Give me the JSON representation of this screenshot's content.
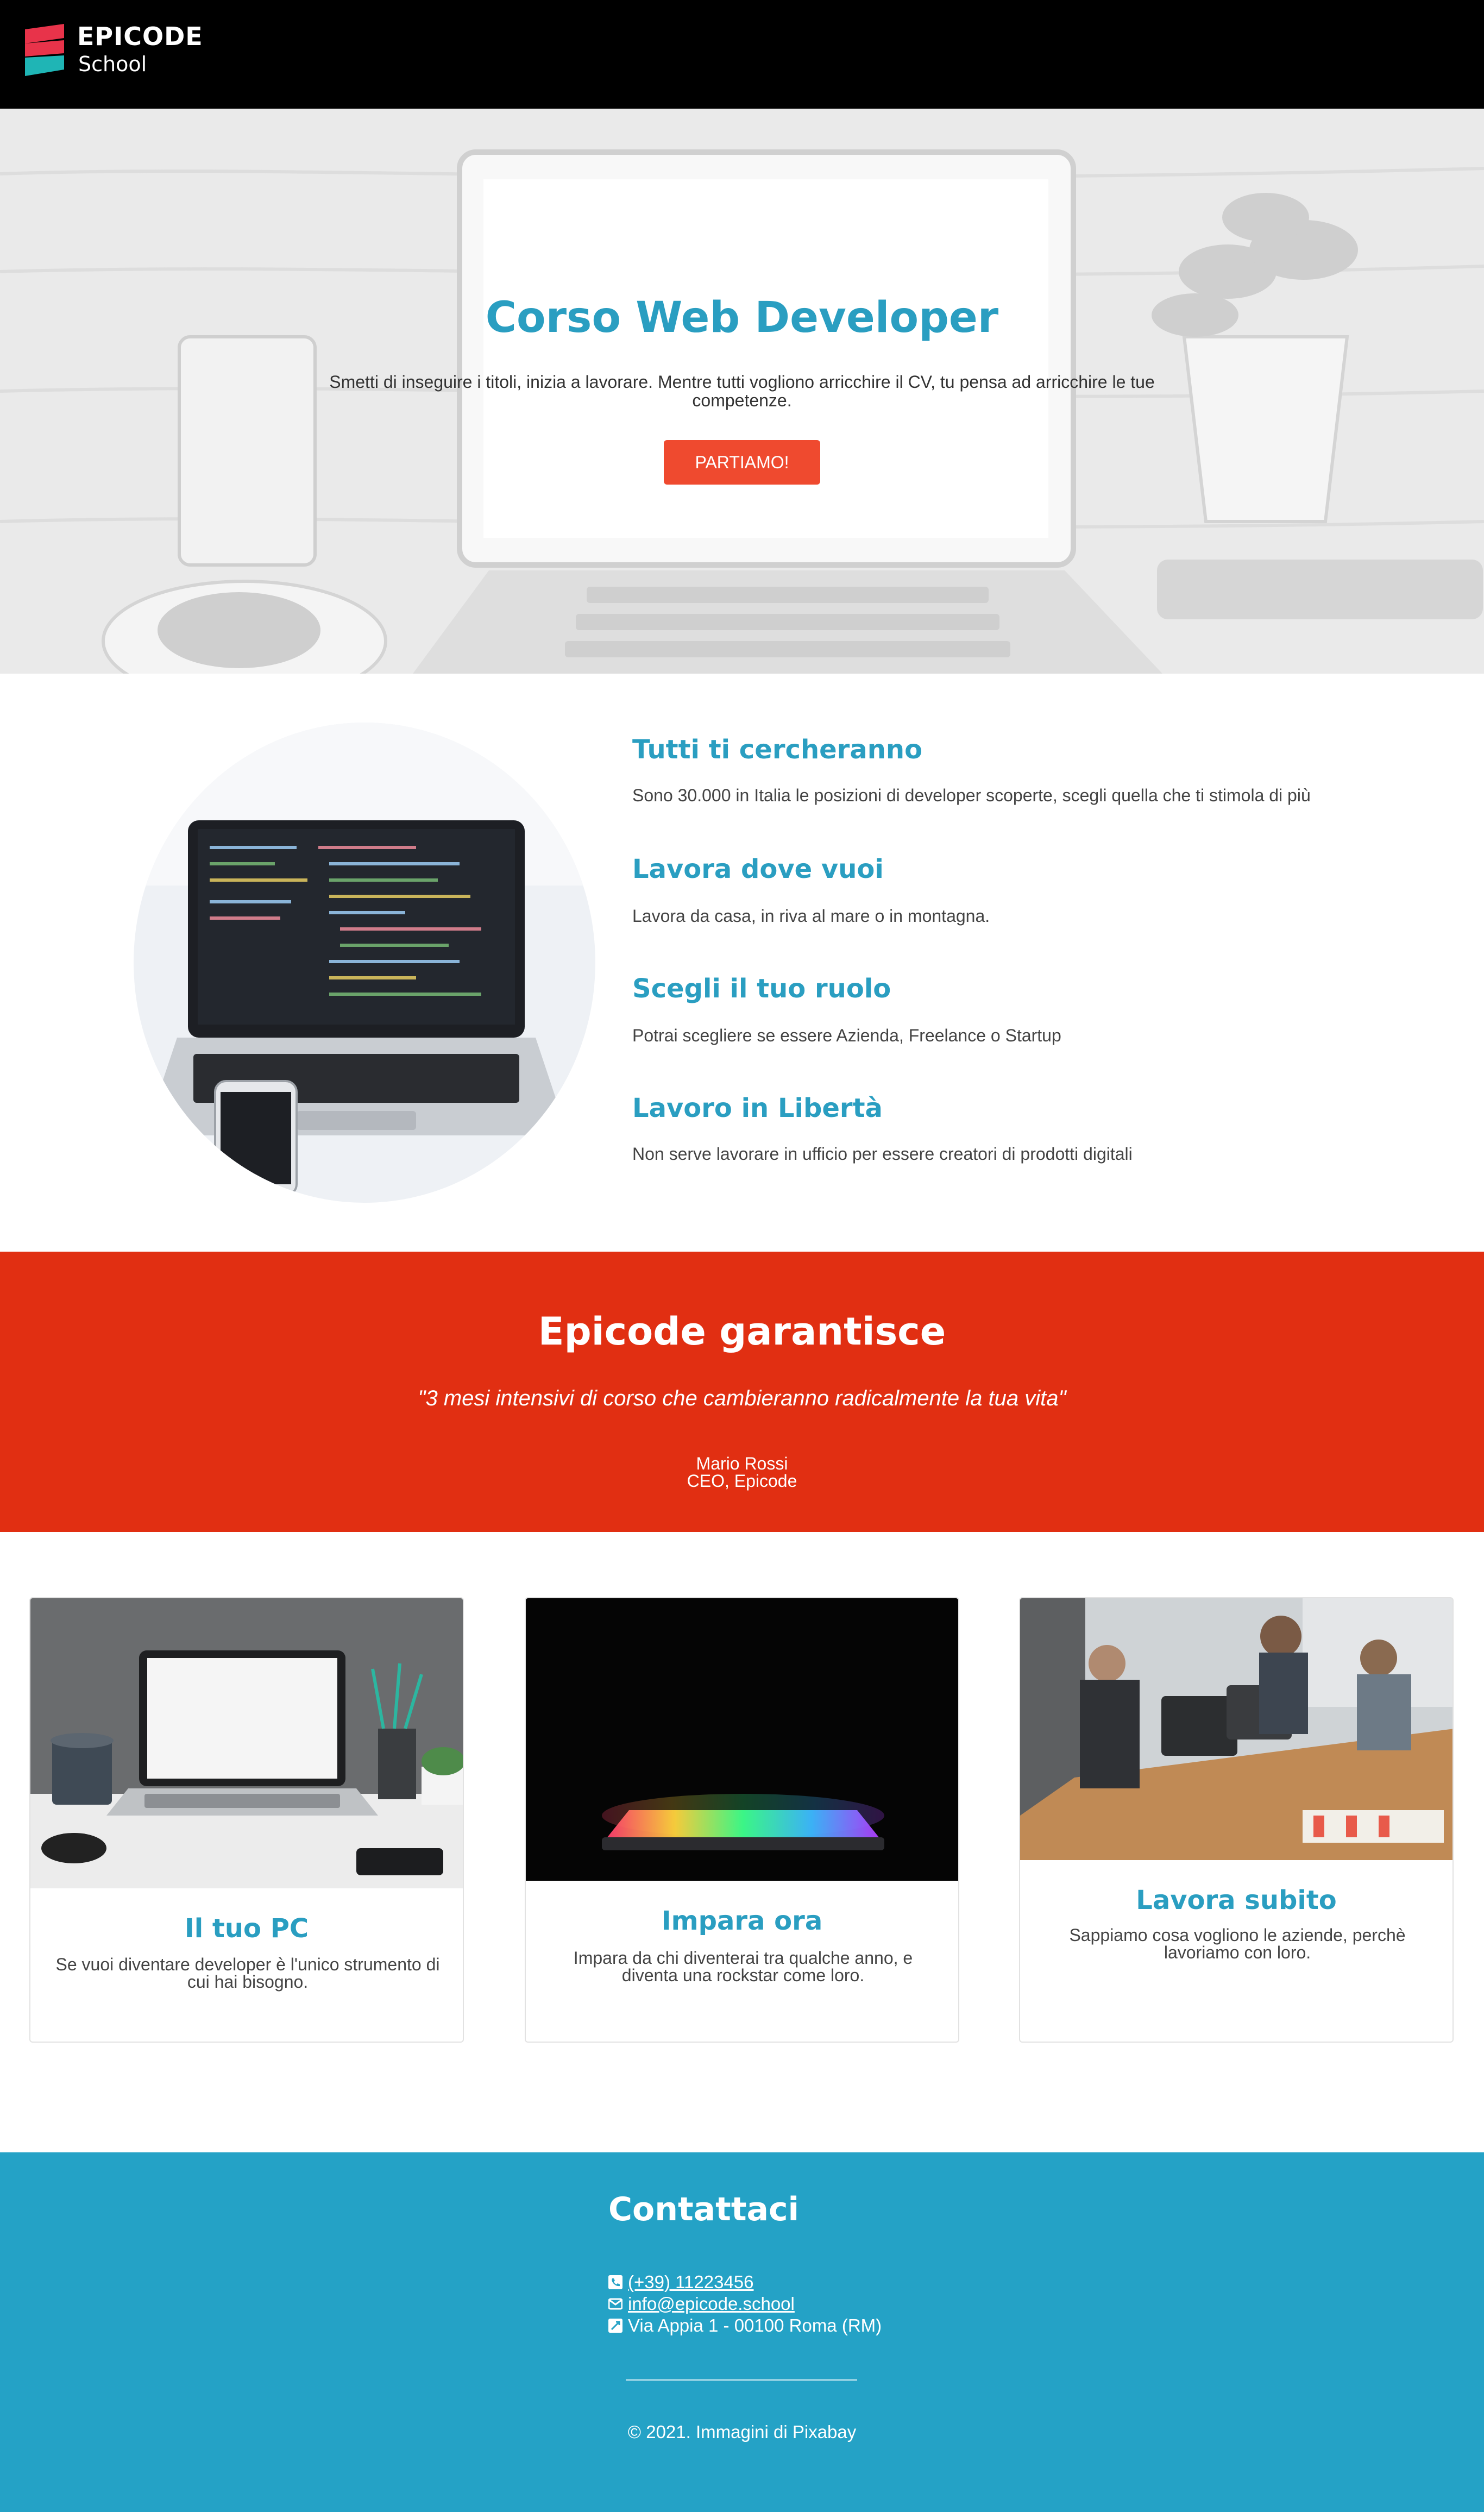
{
  "header": {
    "brand_line1": "EPICODE",
    "brand_line2": "School",
    "colors": {
      "logo_red": "#e8334a",
      "logo_teal": "#1fb5b5"
    }
  },
  "hero": {
    "title": "Corso Web Developer",
    "subtitle": "Smetti di inseguire i titoli, inizia a lavorare. Mentre tutti vogliono arricchire il CV, tu pensa ad arricchire le tue competenze.",
    "cta_label": "PARTIAMO!"
  },
  "features": [
    {
      "title": "Tutti ti cercheranno",
      "text": "Sono 30.000 in Italia le posizioni di developer scoperte, scegli quella che ti stimola di più"
    },
    {
      "title": "Lavora dove vuoi",
      "text": "Lavora da casa, in riva al mare o in montagna."
    },
    {
      "title": "Scegli il tuo ruolo",
      "text": "Potrai scegliere se essere Azienda, Freelance o Startup"
    },
    {
      "title": "Lavoro in Libertà",
      "text": "Non serve lavorare in ufficio per essere creatori di prodotti digitali"
    }
  ],
  "guarantee": {
    "title": "Epicode garantisce",
    "quote": "\"3 mesi intensivi di corso che cambieranno radicalmente la tua vita\"",
    "author_name": "Mario Rossi",
    "author_role": "CEO, Epicode"
  },
  "cards": [
    {
      "title": "Il tuo PC",
      "text": "Se vuoi diventare developer è l'unico strumento di cui hai bisogno."
    },
    {
      "title": "Impara ora",
      "text": "Impara da chi diventerai tra qualche anno, e diventa una rockstar come loro."
    },
    {
      "title": "Lavora subito",
      "text": "Sappiamo cosa vogliono le aziende, perchè lavoriamo con loro."
    }
  ],
  "footer": {
    "title": "Contattaci",
    "phone": "(+39) 11223456",
    "email": "info@epicode.school",
    "address": "Via Appia 1 - 00100 Roma (RM)",
    "copyright": "© 2021. Immagini di Pixabay"
  },
  "colors": {
    "accent_blue": "#2a9ec1",
    "cta_orange": "#ef4a2f",
    "band_red": "#e12f12",
    "footer_blue": "#24a2c6"
  }
}
